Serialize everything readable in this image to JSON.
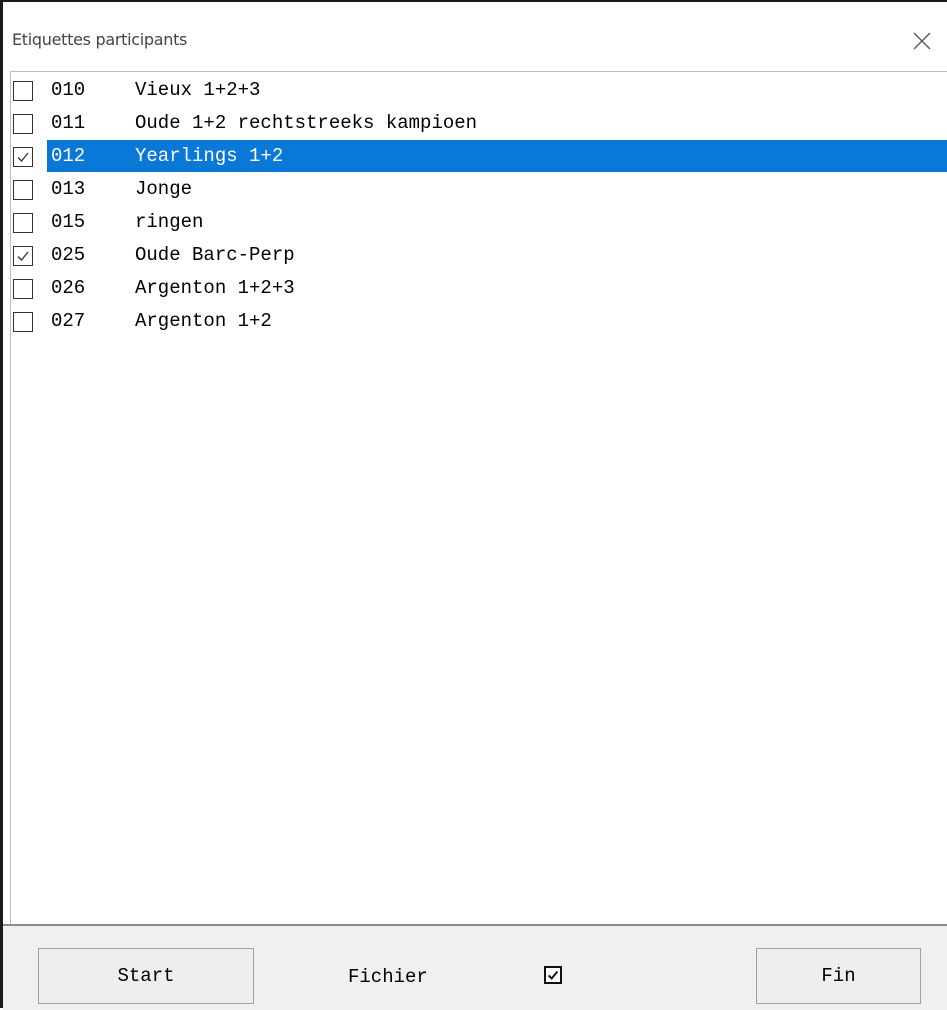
{
  "window": {
    "title": "Etiquettes participants"
  },
  "items": [
    {
      "code": "010",
      "label": "Vieux 1+2+3",
      "checked": false,
      "selected": false
    },
    {
      "code": "011",
      "label": "Oude 1+2 rechtstreeks kampioen",
      "checked": false,
      "selected": false
    },
    {
      "code": "012",
      "label": "Yearlings 1+2",
      "checked": true,
      "selected": true
    },
    {
      "code": "013",
      "label": "Jonge",
      "checked": false,
      "selected": false
    },
    {
      "code": "015",
      "label": "ringen",
      "checked": false,
      "selected": false
    },
    {
      "code": "025",
      "label": "Oude Barc-Perp",
      "checked": true,
      "selected": false
    },
    {
      "code": "026",
      "label": "Argenton 1+2+3",
      "checked": false,
      "selected": false
    },
    {
      "code": "027",
      "label": "Argenton 1+2",
      "checked": false,
      "selected": false
    }
  ],
  "footer": {
    "start_label": "Start",
    "fichier_label": "Fichier",
    "fichier_checked": true,
    "fin_label": "Fin"
  },
  "colors": {
    "selection": "#0a78d7",
    "footer_bg": "#f0f0f0"
  },
  "icons": {
    "close": "close-icon",
    "check": "checkmark-icon"
  }
}
